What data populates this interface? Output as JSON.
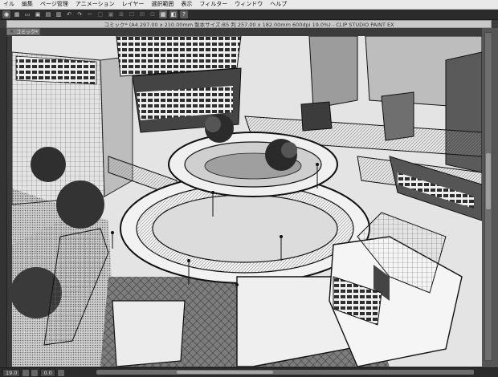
{
  "menubar": {
    "items": [
      "イル",
      "編集",
      "ページ管理",
      "アニメーション",
      "レイヤー",
      "選択範囲",
      "表示",
      "フィルター",
      "ウィンドウ",
      "ヘルプ"
    ]
  },
  "toolbar": {
    "buttons": [
      "◉",
      "▦",
      "▭",
      "▣",
      "▤",
      "▥",
      "↶",
      "↷",
      "✂",
      "▢",
      "▣",
      "⊞",
      "☐",
      "☒",
      "⊡",
      "▦",
      "◧",
      "?"
    ]
  },
  "document": {
    "title": "コミック* (A4 297.00 x 210.00mm 製本サイズ:B5 判 257.00 x 182.00mm 600dpi 19.0%) - CLIP STUDIO PAINT EX",
    "tab_label": "コミック*",
    "tab_close": "×"
  },
  "statusbar": {
    "zoom": "19.0",
    "angle": "0.0"
  }
}
